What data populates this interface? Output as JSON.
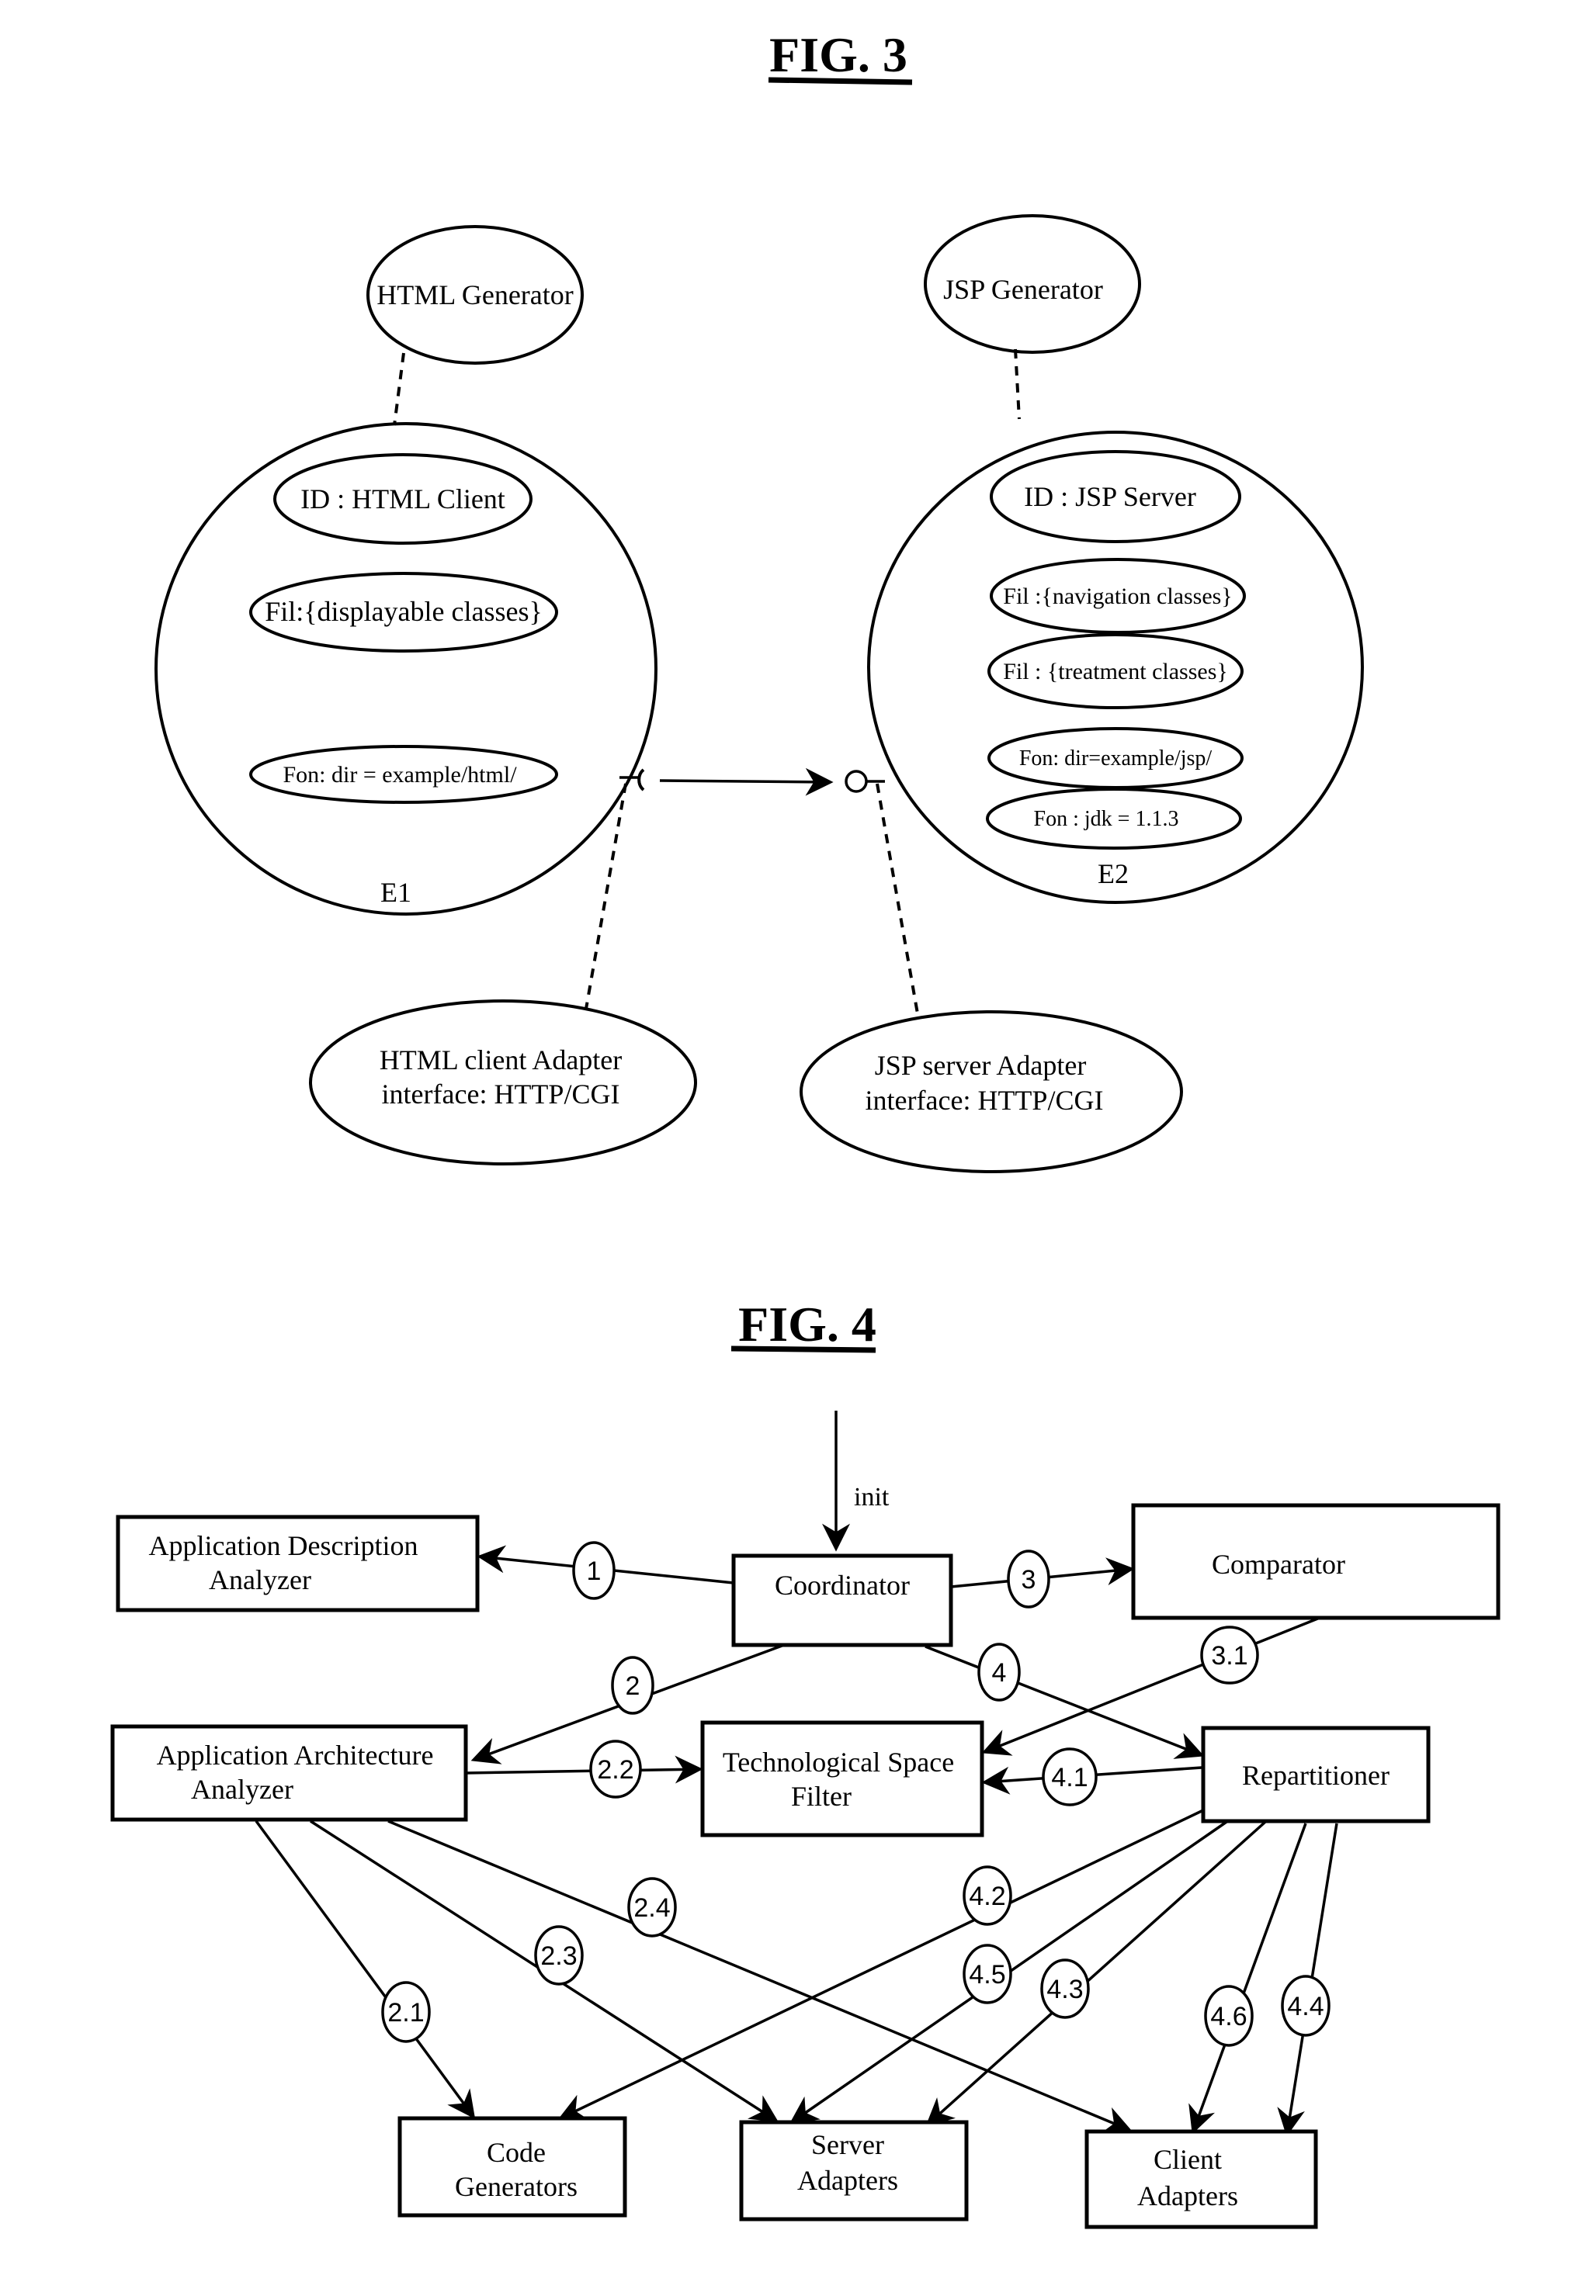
{
  "fig3": {
    "title": "FIG. 3",
    "html_generator": "HTML Generator",
    "jsp_generator": "JSP Generator",
    "e1": {
      "label": "E1",
      "id": "ID : HTML Client",
      "fil": "Fil:{displayable classes}",
      "fon": "Fon: dir = example/html/"
    },
    "e2": {
      "label": "E2",
      "id": "ID :  JSP Server",
      "fil_nav": "Fil :{navigation classes}",
      "fil_treat": "Fil :  {treatment classes}",
      "fon_dir": "Fon: dir=example/jsp/",
      "fon_jdk": "Fon : jdk = 1.1.3"
    },
    "html_adapter": {
      "line1": "HTML client Adapter",
      "line2": "interface: HTTP/CGI"
    },
    "jsp_adapter": {
      "line1": "JSP server Adapter",
      "line2": "interface: HTTP/CGI"
    }
  },
  "fig4": {
    "title": "FIG. 4",
    "init_label": "init",
    "boxes": {
      "app_desc": [
        "Application Description",
        "Analyzer"
      ],
      "coordinator": [
        "Coordinator"
      ],
      "comparator": [
        "Comparator"
      ],
      "app_arch": [
        "Application Architecture",
        "Analyzer"
      ],
      "tech_filter": [
        "Technological Space",
        "Filter"
      ],
      "repartitioner": [
        "Repartitioner"
      ],
      "code_gen": [
        "Code",
        "Generators"
      ],
      "server_adapters": [
        "Server",
        "Adapters"
      ],
      "client_adapters": [
        "Client",
        "Adapters"
      ]
    },
    "steps": {
      "s1": "1",
      "s2": "2",
      "s3": "3",
      "s4": "4",
      "s3_1": "3.1",
      "s2_2": "2.2",
      "s4_1": "4.1",
      "s2_4": "2.4",
      "s4_2": "4.2",
      "s2_3": "2.3",
      "s4_5": "4.5",
      "s4_3": "4.3",
      "s2_1": "2.1",
      "s4_6": "4.6",
      "s4_4": "4.4"
    }
  }
}
